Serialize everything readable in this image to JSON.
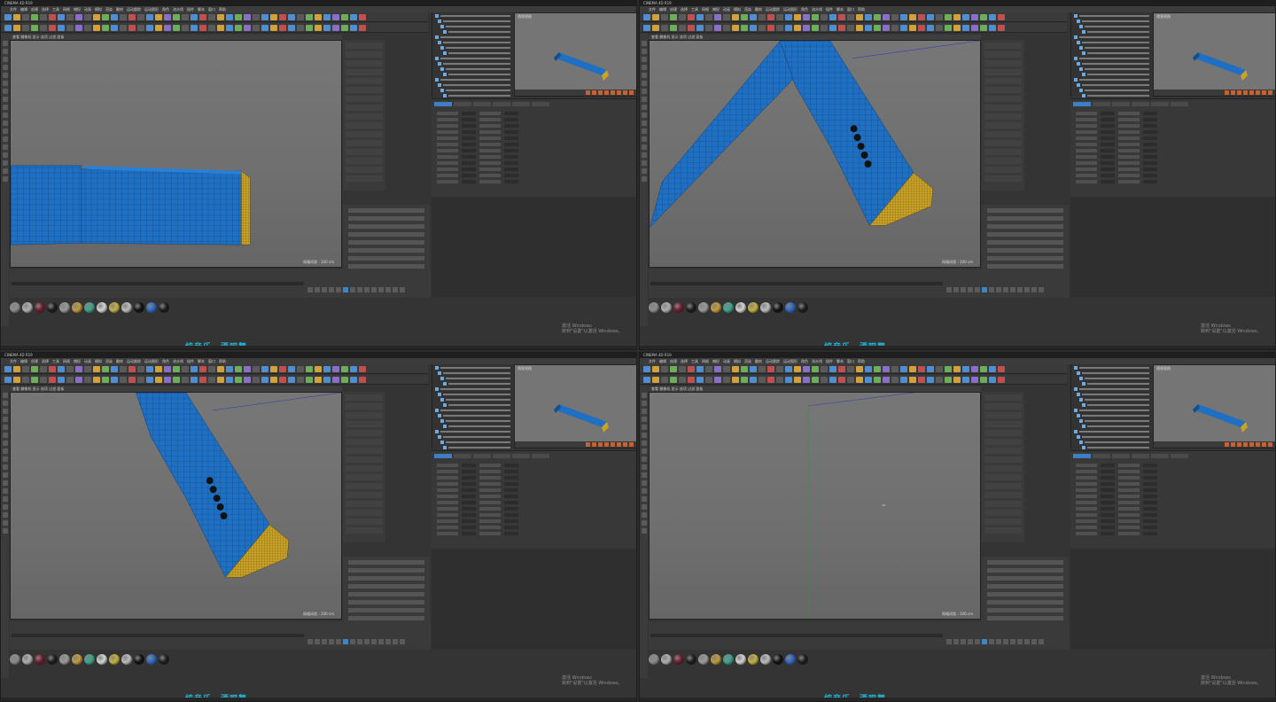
{
  "app": {
    "window_title": "CINEMA 4D R19",
    "menu": [
      "文件",
      "编辑",
      "创建",
      "选择",
      "工具",
      "网格",
      "捕捉",
      "动画",
      "模拟",
      "渲染",
      "雕刻",
      "运动跟踪",
      "运动图形",
      "角色",
      "流水线",
      "插件",
      "脚本",
      "窗口",
      "帮助"
    ]
  },
  "viewport": {
    "menu": "查看 摄像机 显示 选项 过滤 面板",
    "label": "网格间距 : 100 cm"
  },
  "mini_viewport": {
    "label": "透视视图"
  },
  "properties": {
    "tabs": [
      "基本",
      "坐标",
      "对象",
      "平滑着色(Phong)",
      "封顶",
      "选集"
    ]
  },
  "watermark": {
    "line1": "激活 Windows",
    "line2": "转到\"设置\"以激活 Windows。"
  },
  "subtitle": "纯音乐、酒吧舞",
  "panes": [
    {
      "scene": "close"
    },
    {
      "scene": "angled"
    },
    {
      "scene": "angled2"
    },
    {
      "scene": "empty"
    }
  ],
  "colors": {
    "mesh_blue": "#1f6fc2",
    "cap_yellow": "#c9a227",
    "subtitle_cyan": "#21b8d8"
  },
  "materials": [
    "#8c8c8c",
    "#b0b0b0",
    "#6b1a2a",
    "#1a1a1a",
    "#9a9a9a",
    "#c49a3a",
    "#3aa58a",
    "#d4d4d4",
    "#c6b23a",
    "#bdbdbd",
    "#101010",
    "#2c67c4",
    "#1b1b1b"
  ]
}
